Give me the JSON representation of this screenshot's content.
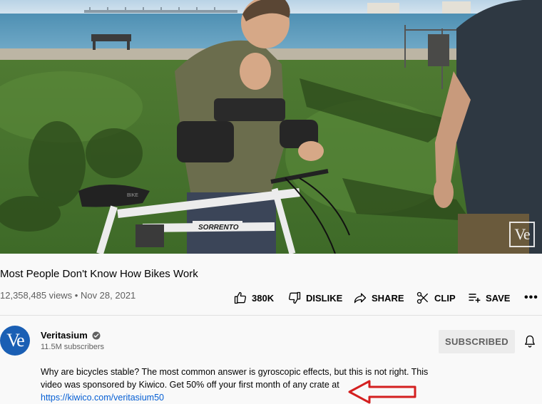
{
  "video": {
    "watermark": "Ve",
    "bike_label": "SORRENTO",
    "seat_label": "BIKE"
  },
  "title": "Most People Don't Know How Bikes Work",
  "meta": "12,358,485 views • Nov 28, 2021",
  "actions": {
    "like": "380K",
    "dislike": "DISLIKE",
    "share": "SHARE",
    "clip": "CLIP",
    "save": "SAVE",
    "more": "•••"
  },
  "channel": {
    "avatar_text": "Ve",
    "name": "Veritasium",
    "subscribers": "11.5M subscribers",
    "subscribe_label": "SUBSCRIBED"
  },
  "description": {
    "line1": "Why are bicycles stable? The most common answer is gyroscopic effects, but this is not right. This",
    "line2": "video was sponsored by Kiwico. Get 50% off your first month of any crate at",
    "link": "https://kiwico.com/veritasium50"
  },
  "colors": {
    "link": "#065fd4",
    "avatar": "#1a5fb4",
    "annotation_arrow": "#d42020"
  },
  "icons": {
    "like": "thumbs-up-icon",
    "dislike": "thumbs-down-icon",
    "share": "share-icon",
    "clip": "scissors-icon",
    "save": "playlist-add-icon",
    "verified": "verified-check-icon",
    "bell": "bell-icon"
  }
}
